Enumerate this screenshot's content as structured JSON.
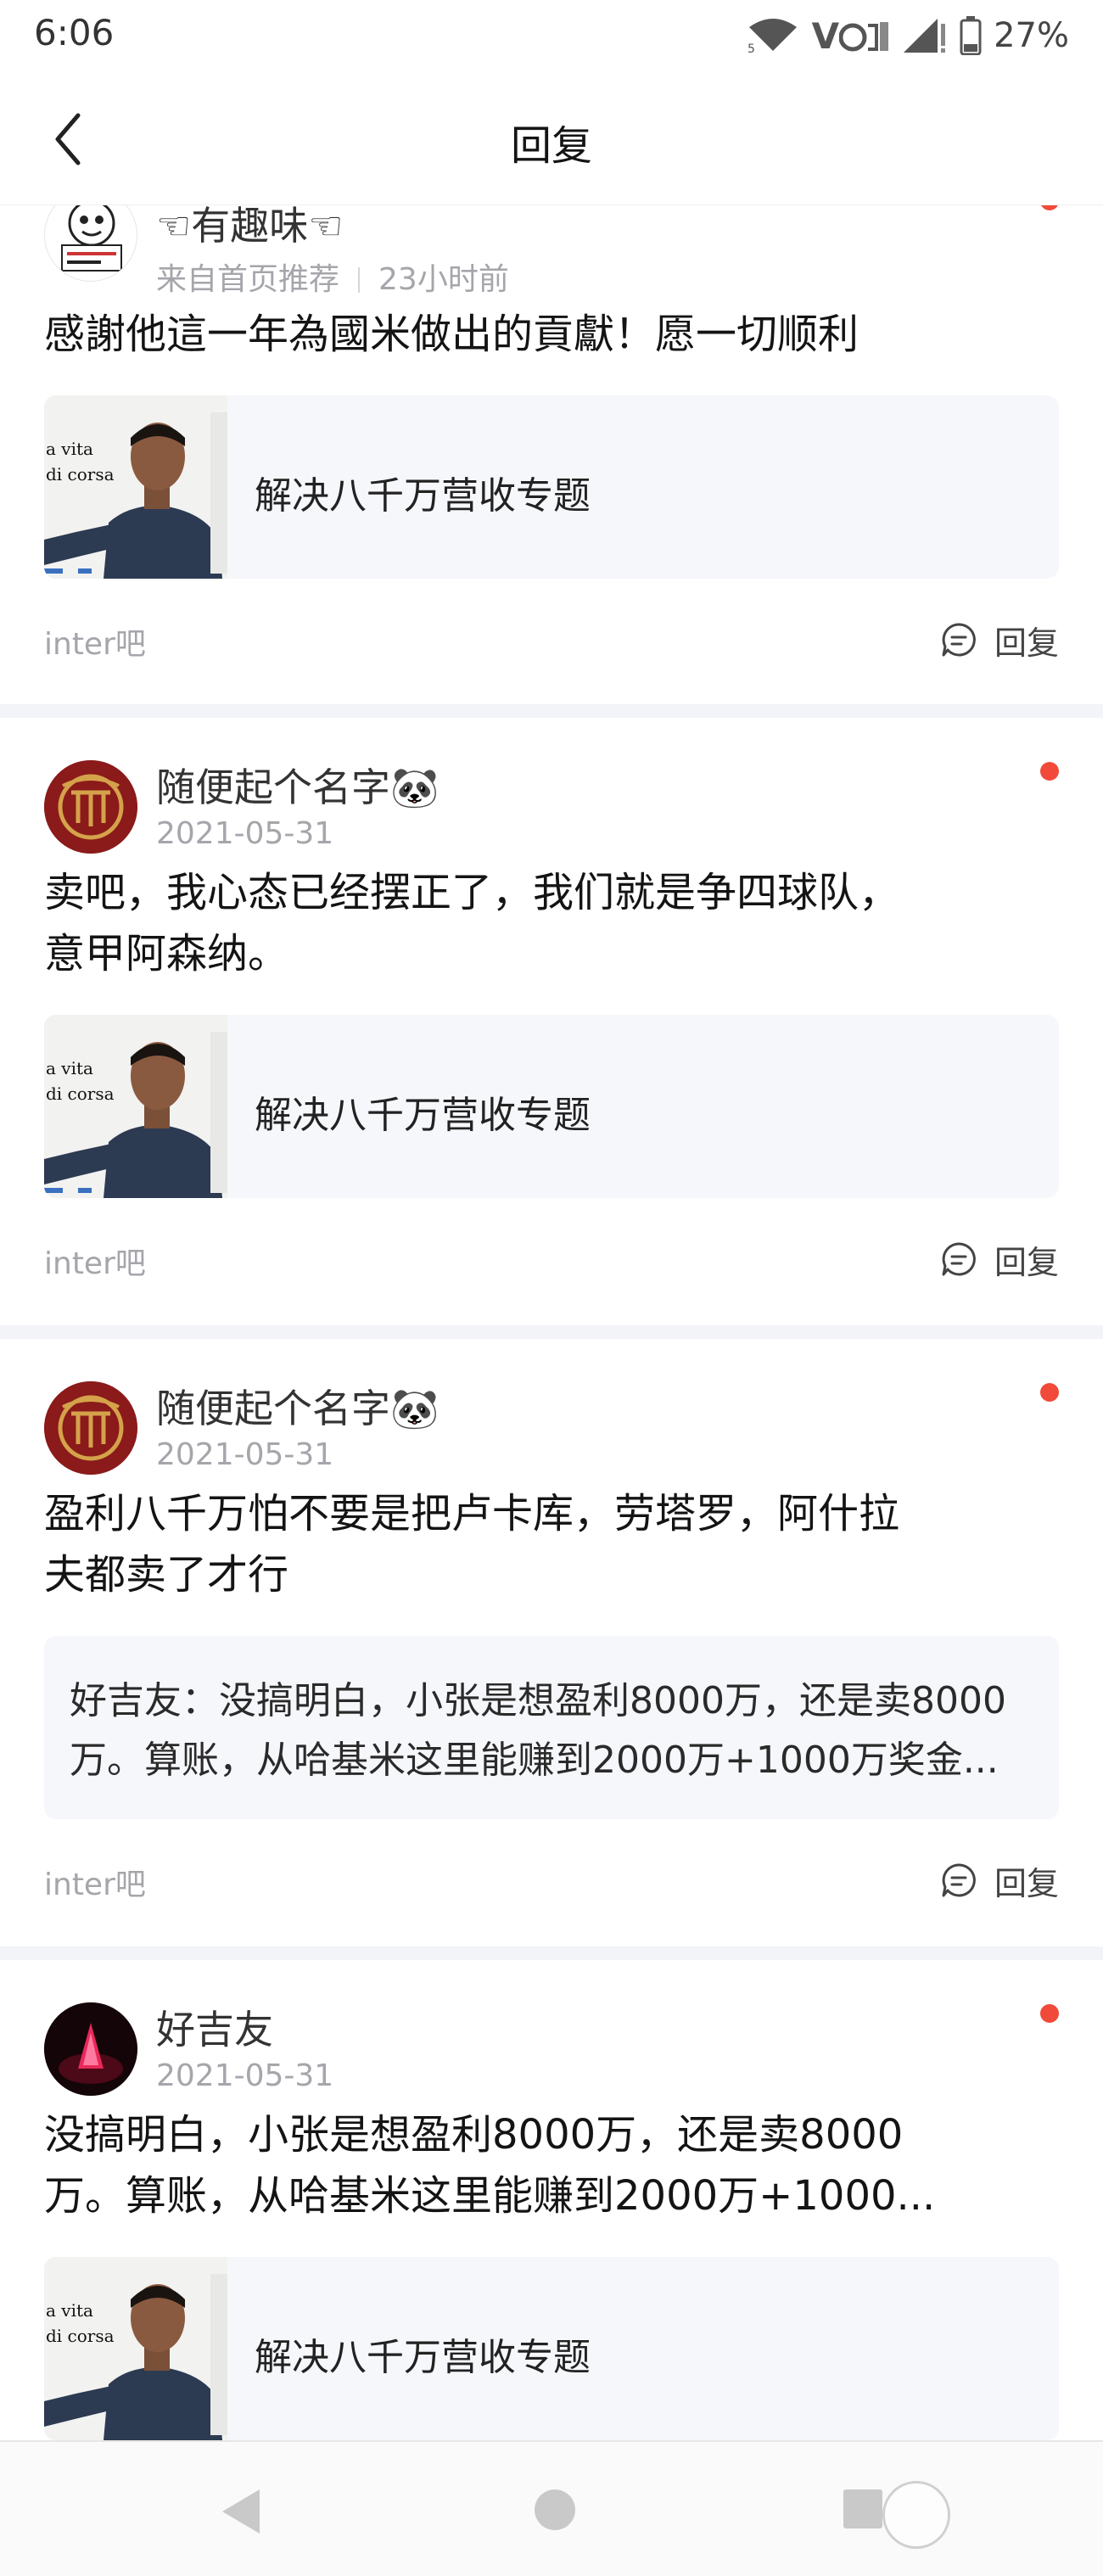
{
  "status_bar": {
    "time": "6:06",
    "battery": "27%",
    "volte_label": "V",
    "network_small": "5"
  },
  "header": {
    "title": "回复"
  },
  "replies": [
    {
      "username": "☜有趣味☜",
      "source": "来自首页推荐",
      "time": "23小时前",
      "content": "感謝他這一年為國米做出的貢獻！愿一切顺利",
      "thread_title": "解决八千万营收专题",
      "thumb_text": [
        "a vita",
        "di corsa"
      ],
      "forum": "inter吧",
      "reply_label": "回复"
    },
    {
      "username": "随便起个名字🐼",
      "time": "2021-05-31",
      "content_lines": [
        "卖吧，我心态已经摆正了，我们就是争四球队，",
        "意甲阿森纳。"
      ],
      "thread_title": "解决八千万营收专题",
      "thumb_text": [
        "a vita",
        "di corsa"
      ],
      "forum": "inter吧",
      "reply_label": "回复"
    },
    {
      "username": "随便起个名字🐼",
      "time": "2021-05-31",
      "content_lines": [
        "盈利八千万怕不要是把卢卡库，劳塔罗，阿什拉",
        "夫都卖了才行"
      ],
      "quote_lines": [
        "好吉友：没搞明白，小张是想盈利8000万，还是卖8000",
        "万。算账，从哈基米这里能赚到2000万+1000万奖金..."
      ],
      "forum": "inter吧",
      "reply_label": "回复"
    },
    {
      "username": "好吉友",
      "time": "2021-05-31",
      "content_lines": [
        "没搞明白，小张是想盈利8000万，还是卖8000",
        "万。算账，从哈基米这里能赚到2000万+1000..."
      ],
      "thread_title": "解决八千万营收专题",
      "thumb_text": [
        "a vita",
        "di corsa"
      ]
    }
  ],
  "colors": {
    "accent_dot": "#f14a3a",
    "meta_text": "#a5a5ab",
    "box_bg": "#f6f7fb",
    "separator": "#f3f4f8",
    "inter_badge": "#8b1a1a"
  }
}
